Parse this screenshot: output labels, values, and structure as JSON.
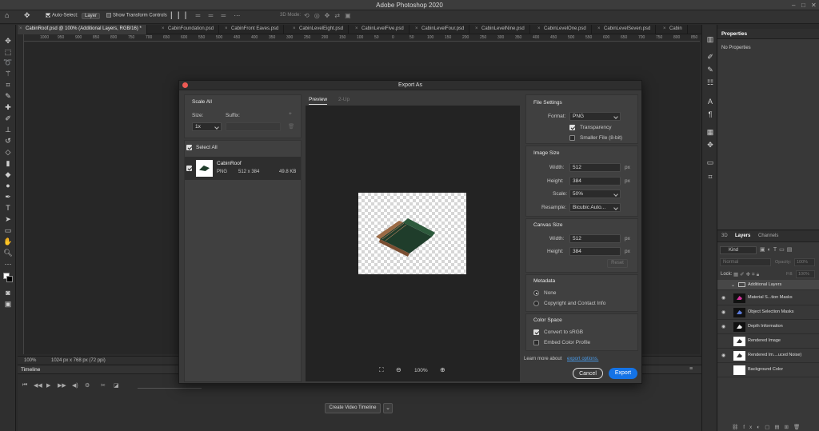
{
  "app": {
    "title": "Adobe Photoshop 2020"
  },
  "options_bar": {
    "auto_select_label": "Auto-Select:",
    "auto_select_value": "Layer",
    "show_transform_label": "Show Transform Controls",
    "mode_3d": "3D Mode:"
  },
  "tabs": [
    {
      "label": "CabinRoof.psd @ 100% (Additional Layers, RGB/16) *"
    },
    {
      "label": "CabinFoundation.psd"
    },
    {
      "label": "CabinFront Eaves.psd"
    },
    {
      "label": "CabinLevelEight.psd"
    },
    {
      "label": "CabinLevelFive.psd"
    },
    {
      "label": "CabinLevelFour.psd"
    },
    {
      "label": "CabinLevelNine.psd"
    },
    {
      "label": "CabinLevelOne.psd"
    },
    {
      "label": "CabinLevelSeven.psd"
    },
    {
      "label": "Cabin"
    }
  ],
  "ruler": {
    "marks": [
      "1000",
      "950",
      "900",
      "850",
      "800",
      "750",
      "700",
      "650",
      "600",
      "550",
      "500",
      "450",
      "400",
      "350",
      "300",
      "250",
      "200",
      "150",
      "100",
      "50",
      "0",
      "50",
      "100",
      "150",
      "200",
      "250",
      "300",
      "350",
      "400",
      "450",
      "500",
      "550",
      "600",
      "650",
      "700",
      "750",
      "800",
      "850",
      "900"
    ]
  },
  "status": {
    "zoom": "100%",
    "doc_info": "1024 px x 768 px (72 ppi)"
  },
  "timeline": {
    "title": "Timeline",
    "create_button": "Create Video Timeline"
  },
  "properties": {
    "title": "Properties",
    "empty": "No Properties"
  },
  "layers_panel": {
    "tabs": [
      "3D",
      "Layers",
      "Channels"
    ],
    "kind_label": "Kind",
    "blend_mode": "Normal",
    "opacity_label": "Opacity:",
    "opacity_value": "100%",
    "lock_label": "Lock:",
    "fill_label": "Fill:",
    "fill_value": "100%",
    "layers": [
      {
        "name": "Additional Layers",
        "type": "group"
      },
      {
        "name": "Material S...tion Masks",
        "visible": true
      },
      {
        "name": "Object Selection Masks",
        "visible": true
      },
      {
        "name": "Depth Information",
        "visible": true
      },
      {
        "name": "Rendered Image",
        "visible": false
      },
      {
        "name": "Rendered Im....uced Noise)",
        "visible": true
      },
      {
        "name": "Background Color",
        "visible": false
      }
    ]
  },
  "export_dialog": {
    "title": "Export As",
    "scale_all": {
      "heading": "Scale All",
      "size_label": "Size:",
      "suffix_label": "Suffix:",
      "size_value": "1x",
      "select_all": "Select All"
    },
    "asset": {
      "name": "CabinRoof",
      "format": "PNG",
      "dimensions": "512 x 384",
      "file_size": "49.8 KB"
    },
    "preview_tabs": [
      "Preview",
      "2-Up"
    ],
    "zoom": "100%",
    "file_settings": {
      "heading": "File Settings",
      "format_label": "Format:",
      "format_value": "PNG",
      "transparency": "Transparency",
      "transparency_checked": true,
      "smaller_file": "Smaller File (8-bit)",
      "smaller_file_checked": false
    },
    "image_size": {
      "heading": "Image Size",
      "width_label": "Width:",
      "width": "512",
      "height_label": "Height:",
      "height": "384",
      "unit": "px",
      "scale_label": "Scale:",
      "scale": "50%",
      "resample_label": "Resample:",
      "resample": "Bicubic Auto..."
    },
    "canvas_size": {
      "heading": "Canvas Size",
      "width_label": "Width:",
      "width": "512",
      "height_label": "Height:",
      "height": "384",
      "unit": "px",
      "reset": "Reset"
    },
    "metadata": {
      "heading": "Metadata",
      "none": "None",
      "copyright": "Copyright and Contact Info",
      "selected": "None"
    },
    "color_space": {
      "heading": "Color Space",
      "convert": "Convert to sRGB",
      "convert_checked": true,
      "embed": "Embed Color Profile",
      "embed_checked": false
    },
    "learn_more": "Learn more about",
    "learn_more_link": "export options.",
    "cancel": "Cancel",
    "export": "Export"
  },
  "colors": {
    "accent": "#1473e6",
    "close_red": "#ed5a54",
    "roof_green": "#1f3d2b",
    "roof_wood": "#8a5a3a"
  }
}
